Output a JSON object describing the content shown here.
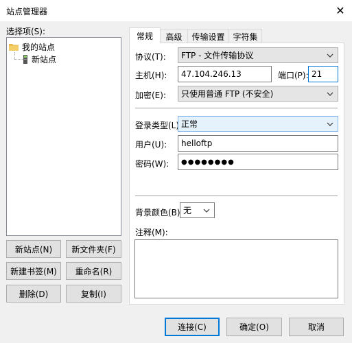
{
  "window": {
    "title": "站点管理器",
    "close_glyph": "✕"
  },
  "left": {
    "select_label": "选择项(S):",
    "tree": {
      "root_label": "我的站点",
      "child_label": "新站点"
    },
    "buttons": {
      "new_site": "新站点(N)",
      "new_folder": "新文件夹(F)",
      "new_bookmark": "新建书签(M)",
      "rename": "重命名(R)",
      "delete": "删除(D)",
      "copy": "复制(I)"
    }
  },
  "tabs": [
    "常规",
    "高级",
    "传输设置",
    "字符集"
  ],
  "general": {
    "protocol_label": "协议(T):",
    "protocol_value": "FTP - 文件传输协议",
    "host_label": "主机(H):",
    "host_value": "47.104.246.13",
    "port_label": "端口(P):",
    "port_value": "21",
    "encryption_label": "加密(E):",
    "encryption_value": "只使用普通 FTP (不安全)",
    "logon_type_label": "登录类型(L):",
    "logon_type_value": "正常",
    "user_label": "用户(U):",
    "user_value": "helloftp",
    "password_label": "密码(W):",
    "password_value": "●●●●●●●●",
    "bg_color_label": "背景颜色(B)",
    "bg_color_value": "无",
    "notes_label": "注释(M):"
  },
  "footer": {
    "connect": "连接(C)",
    "ok": "确定(O)",
    "cancel": "取消"
  },
  "colors": {
    "accent": "#0078d7",
    "dialog_bg": "#f0f0f0",
    "folder": "#e8b84b"
  },
  "icons": {
    "root": "folder-icon",
    "child": "server-icon",
    "dropdown": "chevron-down-icon"
  }
}
